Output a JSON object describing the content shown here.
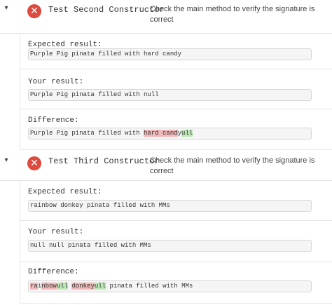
{
  "tests": [
    {
      "name": "Test Second Constructor",
      "description": "Check the main method to verify the signature is correct",
      "expected_label": "Expected result:",
      "expected_value": "Purple Pig pinata filled with hard candy",
      "yours_label": "Your result:",
      "yours_value": "Purple Pig pinata filled with null",
      "diff_label": "Difference:",
      "diff": [
        {
          "t": "Purple Pig pinata filled with ",
          "k": "same"
        },
        {
          "t": "hard cand",
          "k": "del"
        },
        {
          "t": "y",
          "k": "same"
        },
        {
          "t": "ull",
          "k": "ins"
        }
      ]
    },
    {
      "name": "Test Third Constructor",
      "description": "Check the main method to verify the signature is correct",
      "expected_label": "Expected result:",
      "expected_value": "rainbow donkey pinata filled with MMs",
      "yours_label": "Your result:",
      "yours_value": "null null pinata filled with MMs",
      "diff_label": "Difference:",
      "diff": [
        {
          "t": "ra",
          "k": "del"
        },
        {
          "t": "i",
          "k": "same"
        },
        {
          "t": "nbow",
          "k": "del"
        },
        {
          "t": "ull",
          "k": "ins"
        },
        {
          "t": " ",
          "k": "same"
        },
        {
          "t": "d",
          "k": "del"
        },
        {
          "t": "onkey",
          "k": "del"
        },
        {
          "t": "ull",
          "k": "ins"
        },
        {
          "t": " pinata filled with MMs",
          "k": "same"
        }
      ]
    }
  ],
  "icons": {
    "collapse": "chevron-down-icon",
    "status": "fail-x-icon"
  },
  "colors": {
    "fail": "#dc4b3e",
    "deleted": "#f1b9b9",
    "inserted": "#bde6b7"
  }
}
